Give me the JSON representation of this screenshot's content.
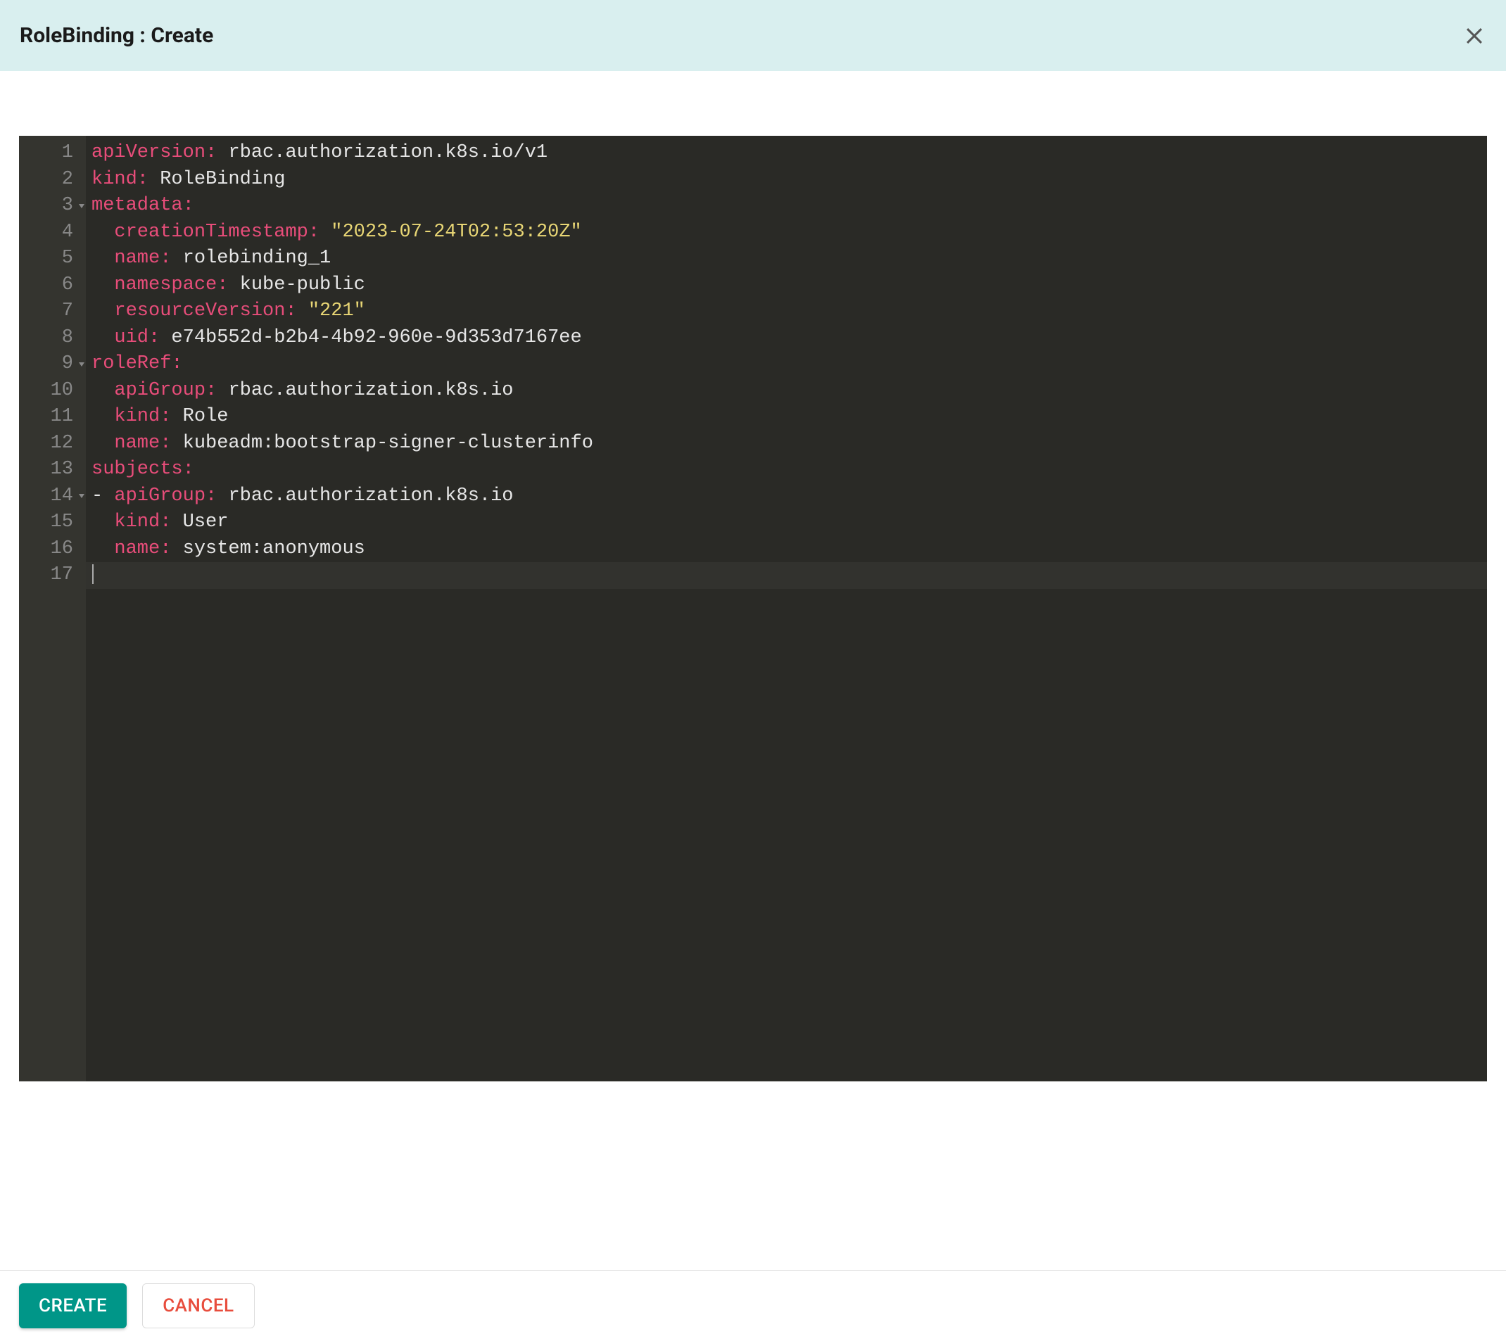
{
  "header": {
    "title": "RoleBinding : Create"
  },
  "editor": {
    "gutter": [
      "1",
      "2",
      "3",
      "4",
      "5",
      "6",
      "7",
      "8",
      "9",
      "10",
      "11",
      "12",
      "13",
      "14",
      "15",
      "16",
      "17"
    ],
    "fold_lines": [
      3,
      9,
      14
    ],
    "current_line": 17,
    "code": [
      {
        "indent": 0,
        "tokens": [
          {
            "t": "key",
            "v": "apiVersion:"
          },
          {
            "t": "sp",
            "v": " "
          },
          {
            "t": "val",
            "v": "rbac.authorization.k8s.io/v1"
          }
        ]
      },
      {
        "indent": 0,
        "tokens": [
          {
            "t": "key",
            "v": "kind:"
          },
          {
            "t": "sp",
            "v": " "
          },
          {
            "t": "val",
            "v": "RoleBinding"
          }
        ]
      },
      {
        "indent": 0,
        "tokens": [
          {
            "t": "key",
            "v": "metadata:"
          }
        ]
      },
      {
        "indent": 1,
        "tokens": [
          {
            "t": "key",
            "v": "creationTimestamp:"
          },
          {
            "t": "sp",
            "v": " "
          },
          {
            "t": "str",
            "v": "\"2023-07-24T02:53:20Z\""
          }
        ]
      },
      {
        "indent": 1,
        "tokens": [
          {
            "t": "key",
            "v": "name:"
          },
          {
            "t": "sp",
            "v": " "
          },
          {
            "t": "val",
            "v": "rolebinding_1"
          }
        ]
      },
      {
        "indent": 1,
        "tokens": [
          {
            "t": "key",
            "v": "namespace:"
          },
          {
            "t": "sp",
            "v": " "
          },
          {
            "t": "val",
            "v": "kube-public"
          }
        ]
      },
      {
        "indent": 1,
        "tokens": [
          {
            "t": "key",
            "v": "resourceVersion:"
          },
          {
            "t": "sp",
            "v": " "
          },
          {
            "t": "str",
            "v": "\"221\""
          }
        ]
      },
      {
        "indent": 1,
        "tokens": [
          {
            "t": "key",
            "v": "uid:"
          },
          {
            "t": "sp",
            "v": " "
          },
          {
            "t": "val",
            "v": "e74b552d-b2b4-4b92-960e-9d353d7167ee"
          }
        ]
      },
      {
        "indent": 0,
        "tokens": [
          {
            "t": "key",
            "v": "roleRef:"
          }
        ]
      },
      {
        "indent": 1,
        "tokens": [
          {
            "t": "key",
            "v": "apiGroup:"
          },
          {
            "t": "sp",
            "v": " "
          },
          {
            "t": "val",
            "v": "rbac.authorization.k8s.io"
          }
        ]
      },
      {
        "indent": 1,
        "tokens": [
          {
            "t": "key",
            "v": "kind:"
          },
          {
            "t": "sp",
            "v": " "
          },
          {
            "t": "val",
            "v": "Role"
          }
        ]
      },
      {
        "indent": 1,
        "tokens": [
          {
            "t": "key",
            "v": "name:"
          },
          {
            "t": "sp",
            "v": " "
          },
          {
            "t": "val",
            "v": "kubeadm:bootstrap-signer-clusterinfo"
          }
        ]
      },
      {
        "indent": 0,
        "tokens": [
          {
            "t": "key",
            "v": "subjects:"
          }
        ]
      },
      {
        "indent": 0,
        "tokens": [
          {
            "t": "dash",
            "v": "- "
          },
          {
            "t": "key",
            "v": "apiGroup:"
          },
          {
            "t": "sp",
            "v": " "
          },
          {
            "t": "val",
            "v": "rbac.authorization.k8s.io"
          }
        ]
      },
      {
        "indent": 1,
        "tokens": [
          {
            "t": "key",
            "v": "kind:"
          },
          {
            "t": "sp",
            "v": " "
          },
          {
            "t": "val",
            "v": "User"
          }
        ]
      },
      {
        "indent": 1,
        "tokens": [
          {
            "t": "key",
            "v": "name:"
          },
          {
            "t": "sp",
            "v": " "
          },
          {
            "t": "val",
            "v": "system:anonymous"
          }
        ]
      },
      {
        "indent": 0,
        "tokens": [],
        "cursor": true
      }
    ]
  },
  "footer": {
    "create_label": "CREATE",
    "cancel_label": "CANCEL"
  }
}
